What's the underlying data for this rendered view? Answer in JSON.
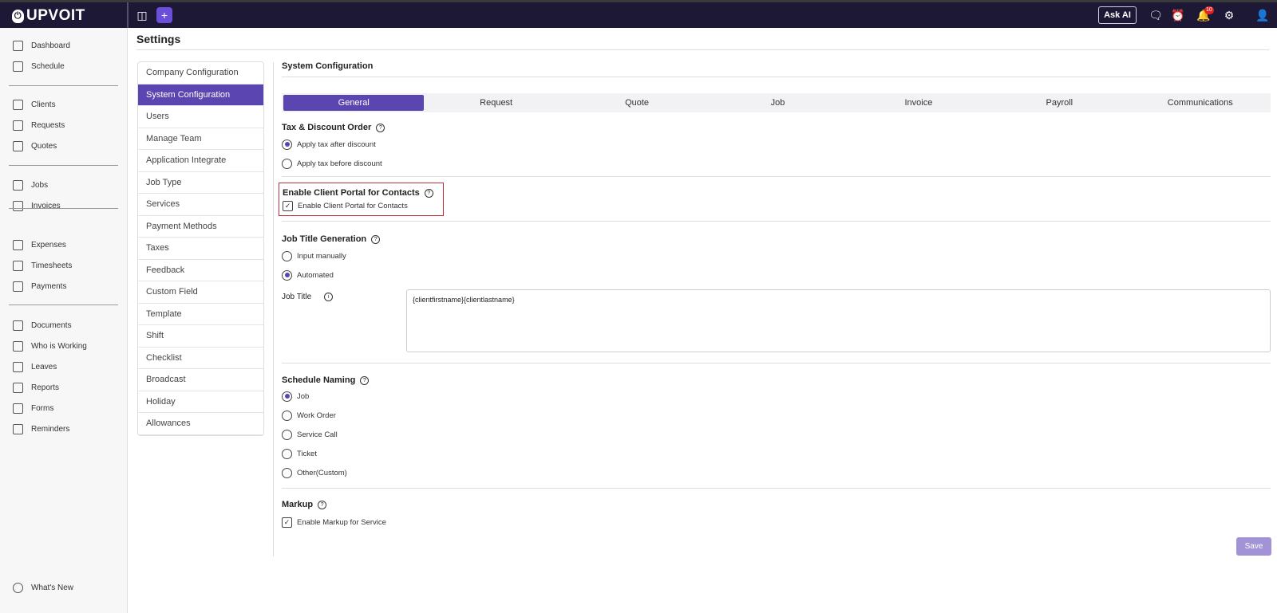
{
  "app": {
    "name": "UPVOIT",
    "ask_ai": "Ask AI",
    "notification_count": "10"
  },
  "sidebar": {
    "items": [
      "Dashboard",
      "Schedule",
      "Clients",
      "Requests",
      "Quotes",
      "Jobs",
      "Invoices",
      "Expenses",
      "Timesheets",
      "Payments",
      "Documents",
      "Who is Working",
      "Leaves",
      "Reports",
      "Forms",
      "Reminders"
    ],
    "whats_new": "What's New"
  },
  "page": {
    "title": "Settings"
  },
  "settings_menu": [
    "Company Configuration",
    "System Configuration",
    "Users",
    "Manage Team",
    "Application Integrate",
    "Job Type",
    "Services",
    "Payment Methods",
    "Taxes",
    "Feedback",
    "Custom Field",
    "Template",
    "Shift",
    "Checklist",
    "Broadcast",
    "Holiday",
    "Allowances"
  ],
  "panel": {
    "title": "System Configuration",
    "tabs": [
      "General",
      "Request",
      "Quote",
      "Job",
      "Invoice",
      "Payroll",
      "Communications"
    ],
    "tax": {
      "title": "Tax & Discount Order",
      "options": [
        "Apply tax after discount",
        "Apply tax before discount"
      ],
      "selected": 0
    },
    "portal": {
      "title": "Enable Client Portal for Contacts",
      "checkbox": "Enable Client Portal for Contacts",
      "checked": true
    },
    "jobtitle": {
      "title": "Job Title Generation",
      "options": [
        "Input manually",
        "Automated"
      ],
      "selected": 1,
      "field_label": "Job Title",
      "field_value": "{clientfirstname}{clientlastname}"
    },
    "schedule": {
      "title": "Schedule Naming",
      "options": [
        "Job",
        "Work Order",
        "Service Call",
        "Ticket",
        "Other(Custom)"
      ],
      "selected": 0
    },
    "markup": {
      "title": "Markup",
      "checkbox": "Enable Markup for Service",
      "checked": true
    },
    "save": "Save"
  },
  "colors": {
    "accent": "#5b45b0",
    "topbar": "#1d1836"
  }
}
